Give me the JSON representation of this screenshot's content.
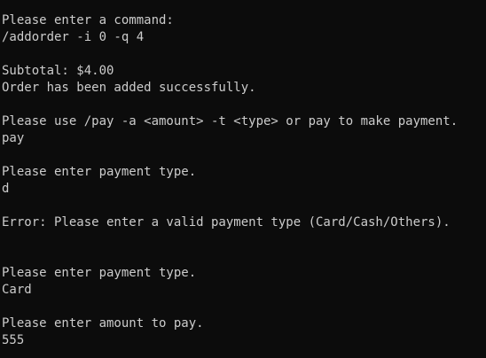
{
  "terminal": {
    "lines": [
      "Please enter a command:",
      "/addorder -i 0 -q 4",
      "",
      "Subtotal: $4.00",
      "Order has been added successfully.",
      "",
      "Please use /pay -a <amount> -t <type> or pay to make payment.",
      "pay",
      "",
      "Please enter payment type.",
      "d",
      "",
      "Error: Please enter a valid payment type (Card/Cash/Others).",
      "",
      "",
      "Please enter payment type.",
      "Card",
      "",
      "Please enter amount to pay.",
      "555"
    ]
  },
  "colors": {
    "background": "#0c0c0c",
    "text": "#cccccc"
  }
}
